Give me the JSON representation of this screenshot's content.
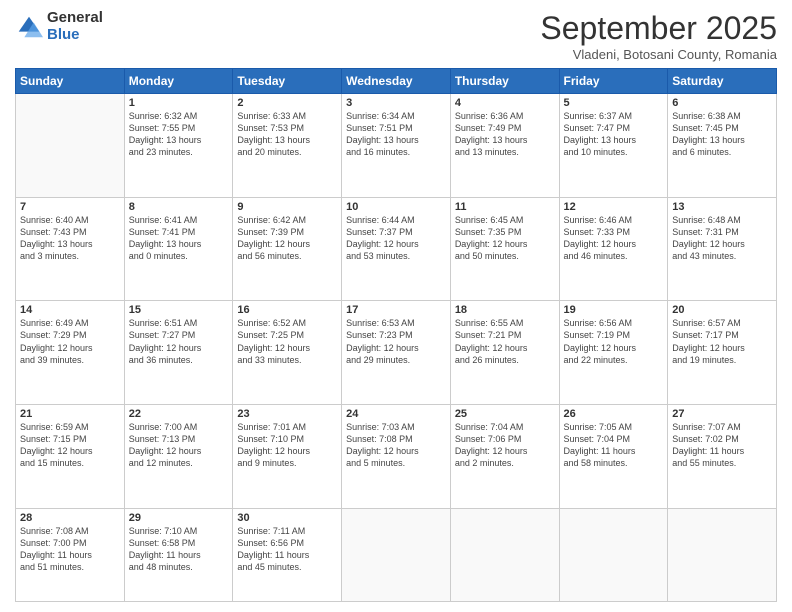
{
  "header": {
    "logo": {
      "general": "General",
      "blue": "Blue"
    },
    "title": "September 2025",
    "location": "Vladeni, Botosani County, Romania"
  },
  "weekdays": [
    "Sunday",
    "Monday",
    "Tuesday",
    "Wednesday",
    "Thursday",
    "Friday",
    "Saturday"
  ],
  "weeks": [
    [
      {
        "day": "",
        "info": ""
      },
      {
        "day": "1",
        "info": "Sunrise: 6:32 AM\nSunset: 7:55 PM\nDaylight: 13 hours\nand 23 minutes."
      },
      {
        "day": "2",
        "info": "Sunrise: 6:33 AM\nSunset: 7:53 PM\nDaylight: 13 hours\nand 20 minutes."
      },
      {
        "day": "3",
        "info": "Sunrise: 6:34 AM\nSunset: 7:51 PM\nDaylight: 13 hours\nand 16 minutes."
      },
      {
        "day": "4",
        "info": "Sunrise: 6:36 AM\nSunset: 7:49 PM\nDaylight: 13 hours\nand 13 minutes."
      },
      {
        "day": "5",
        "info": "Sunrise: 6:37 AM\nSunset: 7:47 PM\nDaylight: 13 hours\nand 10 minutes."
      },
      {
        "day": "6",
        "info": "Sunrise: 6:38 AM\nSunset: 7:45 PM\nDaylight: 13 hours\nand 6 minutes."
      }
    ],
    [
      {
        "day": "7",
        "info": "Sunrise: 6:40 AM\nSunset: 7:43 PM\nDaylight: 13 hours\nand 3 minutes."
      },
      {
        "day": "8",
        "info": "Sunrise: 6:41 AM\nSunset: 7:41 PM\nDaylight: 13 hours\nand 0 minutes."
      },
      {
        "day": "9",
        "info": "Sunrise: 6:42 AM\nSunset: 7:39 PM\nDaylight: 12 hours\nand 56 minutes."
      },
      {
        "day": "10",
        "info": "Sunrise: 6:44 AM\nSunset: 7:37 PM\nDaylight: 12 hours\nand 53 minutes."
      },
      {
        "day": "11",
        "info": "Sunrise: 6:45 AM\nSunset: 7:35 PM\nDaylight: 12 hours\nand 50 minutes."
      },
      {
        "day": "12",
        "info": "Sunrise: 6:46 AM\nSunset: 7:33 PM\nDaylight: 12 hours\nand 46 minutes."
      },
      {
        "day": "13",
        "info": "Sunrise: 6:48 AM\nSunset: 7:31 PM\nDaylight: 12 hours\nand 43 minutes."
      }
    ],
    [
      {
        "day": "14",
        "info": "Sunrise: 6:49 AM\nSunset: 7:29 PM\nDaylight: 12 hours\nand 39 minutes."
      },
      {
        "day": "15",
        "info": "Sunrise: 6:51 AM\nSunset: 7:27 PM\nDaylight: 12 hours\nand 36 minutes."
      },
      {
        "day": "16",
        "info": "Sunrise: 6:52 AM\nSunset: 7:25 PM\nDaylight: 12 hours\nand 33 minutes."
      },
      {
        "day": "17",
        "info": "Sunrise: 6:53 AM\nSunset: 7:23 PM\nDaylight: 12 hours\nand 29 minutes."
      },
      {
        "day": "18",
        "info": "Sunrise: 6:55 AM\nSunset: 7:21 PM\nDaylight: 12 hours\nand 26 minutes."
      },
      {
        "day": "19",
        "info": "Sunrise: 6:56 AM\nSunset: 7:19 PM\nDaylight: 12 hours\nand 22 minutes."
      },
      {
        "day": "20",
        "info": "Sunrise: 6:57 AM\nSunset: 7:17 PM\nDaylight: 12 hours\nand 19 minutes."
      }
    ],
    [
      {
        "day": "21",
        "info": "Sunrise: 6:59 AM\nSunset: 7:15 PM\nDaylight: 12 hours\nand 15 minutes."
      },
      {
        "day": "22",
        "info": "Sunrise: 7:00 AM\nSunset: 7:13 PM\nDaylight: 12 hours\nand 12 minutes."
      },
      {
        "day": "23",
        "info": "Sunrise: 7:01 AM\nSunset: 7:10 PM\nDaylight: 12 hours\nand 9 minutes."
      },
      {
        "day": "24",
        "info": "Sunrise: 7:03 AM\nSunset: 7:08 PM\nDaylight: 12 hours\nand 5 minutes."
      },
      {
        "day": "25",
        "info": "Sunrise: 7:04 AM\nSunset: 7:06 PM\nDaylight: 12 hours\nand 2 minutes."
      },
      {
        "day": "26",
        "info": "Sunrise: 7:05 AM\nSunset: 7:04 PM\nDaylight: 11 hours\nand 58 minutes."
      },
      {
        "day": "27",
        "info": "Sunrise: 7:07 AM\nSunset: 7:02 PM\nDaylight: 11 hours\nand 55 minutes."
      }
    ],
    [
      {
        "day": "28",
        "info": "Sunrise: 7:08 AM\nSunset: 7:00 PM\nDaylight: 11 hours\nand 51 minutes."
      },
      {
        "day": "29",
        "info": "Sunrise: 7:10 AM\nSunset: 6:58 PM\nDaylight: 11 hours\nand 48 minutes."
      },
      {
        "day": "30",
        "info": "Sunrise: 7:11 AM\nSunset: 6:56 PM\nDaylight: 11 hours\nand 45 minutes."
      },
      {
        "day": "",
        "info": ""
      },
      {
        "day": "",
        "info": ""
      },
      {
        "day": "",
        "info": ""
      },
      {
        "day": "",
        "info": ""
      }
    ]
  ]
}
